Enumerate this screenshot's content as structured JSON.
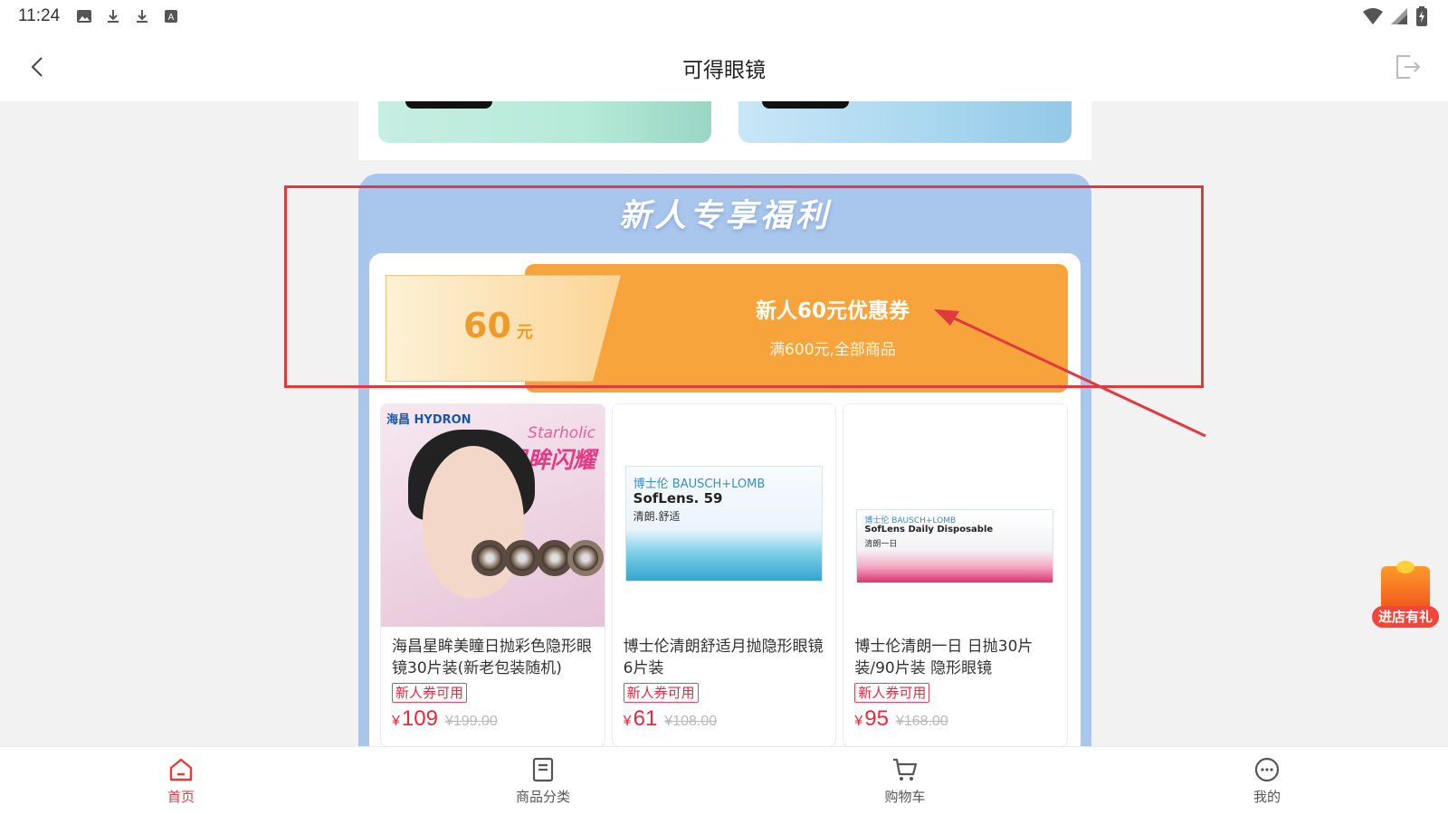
{
  "status_bar": {
    "time": "11:24",
    "left_icons": [
      "image-icon",
      "download-icon",
      "download-icon",
      "font-icon"
    ],
    "right_icons": [
      "wifi-icon",
      "signal-icon",
      "battery-icon"
    ]
  },
  "header": {
    "title": "可得眼镜",
    "back_icon": "chevron-left-icon",
    "exit_icon": "exit-icon"
  },
  "welfare": {
    "title": "新人专享福利",
    "coupon": {
      "amount": "60",
      "unit": "元",
      "name": "新人60元优惠券",
      "desc": "满600元,全部商品"
    }
  },
  "products": [
    {
      "name": "海昌星眸美瞳日抛彩色隐形眼镜30片装(新老包装随机)",
      "tag": "新人券可用",
      "currency": "¥",
      "price": "109",
      "original_price": "¥199.00",
      "image": {
        "brand": "海昌 HYDRON",
        "tagline": "Starholic",
        "title": "星眸闪耀"
      }
    },
    {
      "name": "博士伦清朗舒适月抛隐形眼镜6片装",
      "tag": "新人券可用",
      "currency": "¥",
      "price": "61",
      "original_price": "¥108.00",
      "image": {
        "brand": "博士伦 BAUSCH+LOMB",
        "title": "SofLens. 59",
        "subtitle": "清朗.舒适"
      }
    },
    {
      "name": "博士伦清朗一日 日抛30片装/90片装 隐形眼镜",
      "tag": "新人券可用",
      "currency": "¥",
      "price": "95",
      "original_price": "¥168.00",
      "image": {
        "brand": "博士伦 BAUSCH+LOMB",
        "title": "SofLens Daily Disposable",
        "subtitle": "清朗一日"
      }
    }
  ],
  "floating_gift": {
    "label": "进店有礼",
    "icon": "gift-icon"
  },
  "bottom_nav": [
    {
      "label": "首页",
      "icon": "home-icon",
      "active": true
    },
    {
      "label": "商品分类",
      "icon": "list-icon",
      "active": false
    },
    {
      "label": "购物车",
      "icon": "cart-icon",
      "active": false
    },
    {
      "label": "我的",
      "icon": "profile-icon",
      "active": false
    }
  ],
  "colors": {
    "accent_red": "#e83a3a",
    "coupon_orange": "#f6a43b",
    "welfare_blue": "#a9c6ec",
    "annotation_red": "#e03a40"
  }
}
